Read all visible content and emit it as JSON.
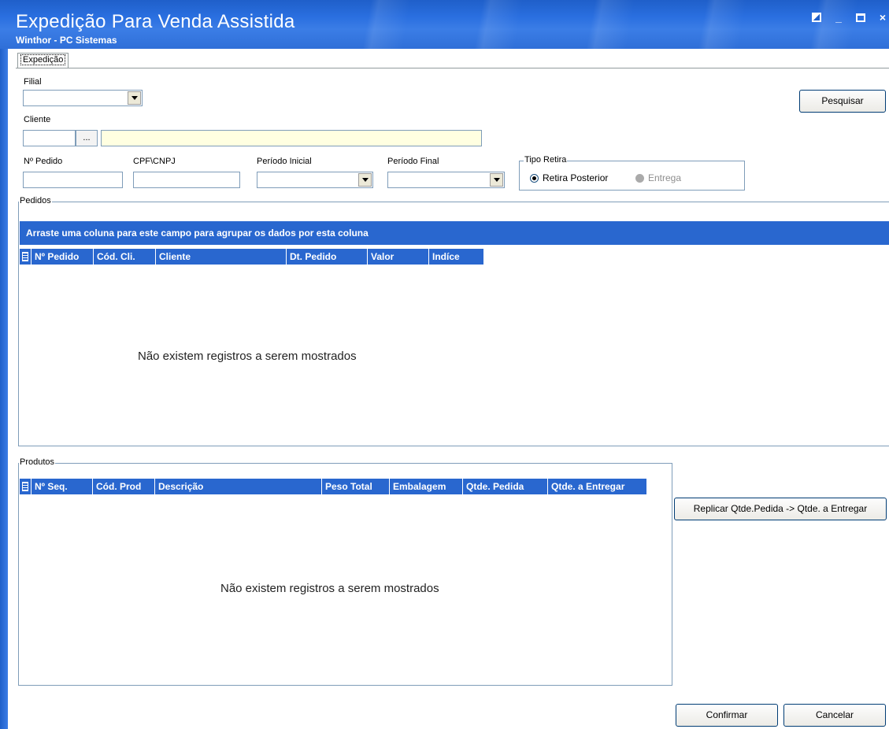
{
  "window": {
    "title": "Expedição Para Venda Assistida",
    "subtitle": "Winthor - PC Sistemas",
    "controls": {
      "minimize": "_",
      "close": "×"
    }
  },
  "tab": {
    "label": "Expedição"
  },
  "filters": {
    "filial_label": "Filial",
    "filial_value": "",
    "cliente_label": "Cliente",
    "cliente_code": "",
    "cliente_lookup": "...",
    "cliente_name": "",
    "pedido_label": "Nº Pedido",
    "cpf_label": "CPF\\CNPJ",
    "periodo_inicial_label": "Período Inicial",
    "periodo_final_label": "Período Final",
    "tipo_retira": {
      "label": "Tipo Retira",
      "options": [
        "Retira Posterior",
        "Entrega"
      ],
      "selected": "Retira Posterior"
    }
  },
  "buttons": {
    "pesquisar": "Pesquisar",
    "replicar": "Replicar Qtde.Pedida -> Qtde. a Entregar",
    "confirmar": "Confirmar",
    "cancelar": "Cancelar"
  },
  "pedidos": {
    "group_label": "Pedidos",
    "group_hint": "Arraste uma coluna para este campo para agrupar os dados por esta coluna",
    "columns": [
      "Nº Pedido",
      "Cód. Cli.",
      "Cliente",
      "Dt. Pedido",
      "Valor",
      "Indíce"
    ],
    "rows": [],
    "empty_text": "Não existem registros a serem mostrados"
  },
  "produtos": {
    "group_label": "Produtos",
    "columns": [
      "Nº Seq.",
      "Cód. Prod",
      "Descrição",
      "Peso Total",
      "Embalagem",
      "Qtde. Pedida",
      "Qtde. a Entregar"
    ],
    "rows": [],
    "empty_text": "Não existem registros a serem mostrados"
  }
}
